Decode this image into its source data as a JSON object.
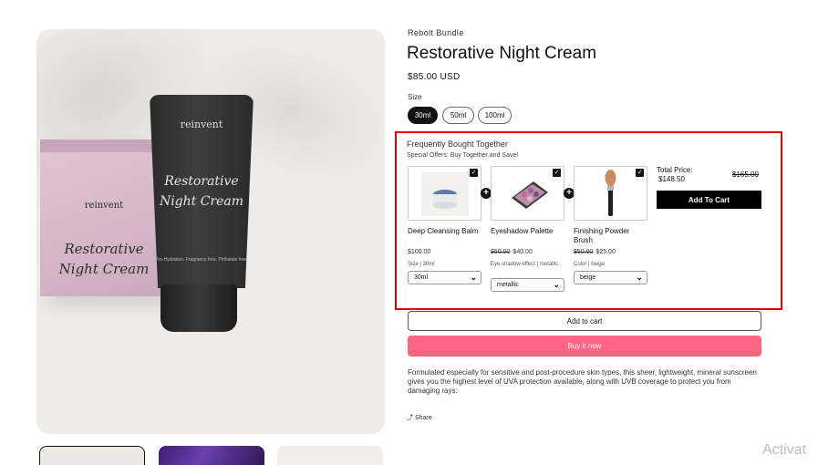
{
  "product": {
    "vendor": "Rebolt Bundle",
    "title": "Restorative Night Cream",
    "price": "$85.00 USD",
    "size_label": "Size",
    "sizes": [
      "30ml",
      "50ml",
      "100ml"
    ],
    "selected_size": "30ml"
  },
  "media": {
    "box_logo": "reinvent",
    "box_title_line1": "Restorative",
    "box_title_line2": "Night Cream",
    "tube_logo": "reinvent",
    "tube_title_line1": "Restorative",
    "tube_title_line2": "Night Cream",
    "tube_small": "Pro-Hydration. Fragrance free. Phthalate free."
  },
  "bundle": {
    "title": "Frequently Bought Together",
    "subtitle": "Special Offers: Buy Together and Save!",
    "items": [
      {
        "name": "Deep Cleansing Balm",
        "old_price": "",
        "price": "$100.00",
        "option_label": "Size",
        "option_value": "30ml",
        "select_value": "30ml"
      },
      {
        "name": "Eyeshadow Palette",
        "old_price": "$50.00",
        "price": "$40.00",
        "option_label": "Eye shadow effect",
        "option_value": "metallic",
        "select_value": "metallic"
      },
      {
        "name": "Finishing Powder Brush",
        "old_price": "$50.00",
        "price": "$25.00",
        "option_label": "Color",
        "option_value": "beige",
        "select_value": "beige"
      }
    ],
    "total_label": "Total Price:",
    "total_price": "$148.50",
    "total_old_price": "$165.00",
    "add_button": "Add To Cart"
  },
  "actions": {
    "add_to_cart": "Add to cart",
    "buy_now": "Buy it now"
  },
  "description": "Formulated especially for sensitive and post-procedure skin types, this sheer, lightweight, mineral sunscreen gives you the highest level of UVA protection available, along with UVB coverage to protect you from damaging rays.",
  "share_label": "Share",
  "watermark": "Activat",
  "colors": {
    "accent_buy": "#ff6583",
    "highlight_border": "#e00000",
    "dark": "#121212"
  }
}
